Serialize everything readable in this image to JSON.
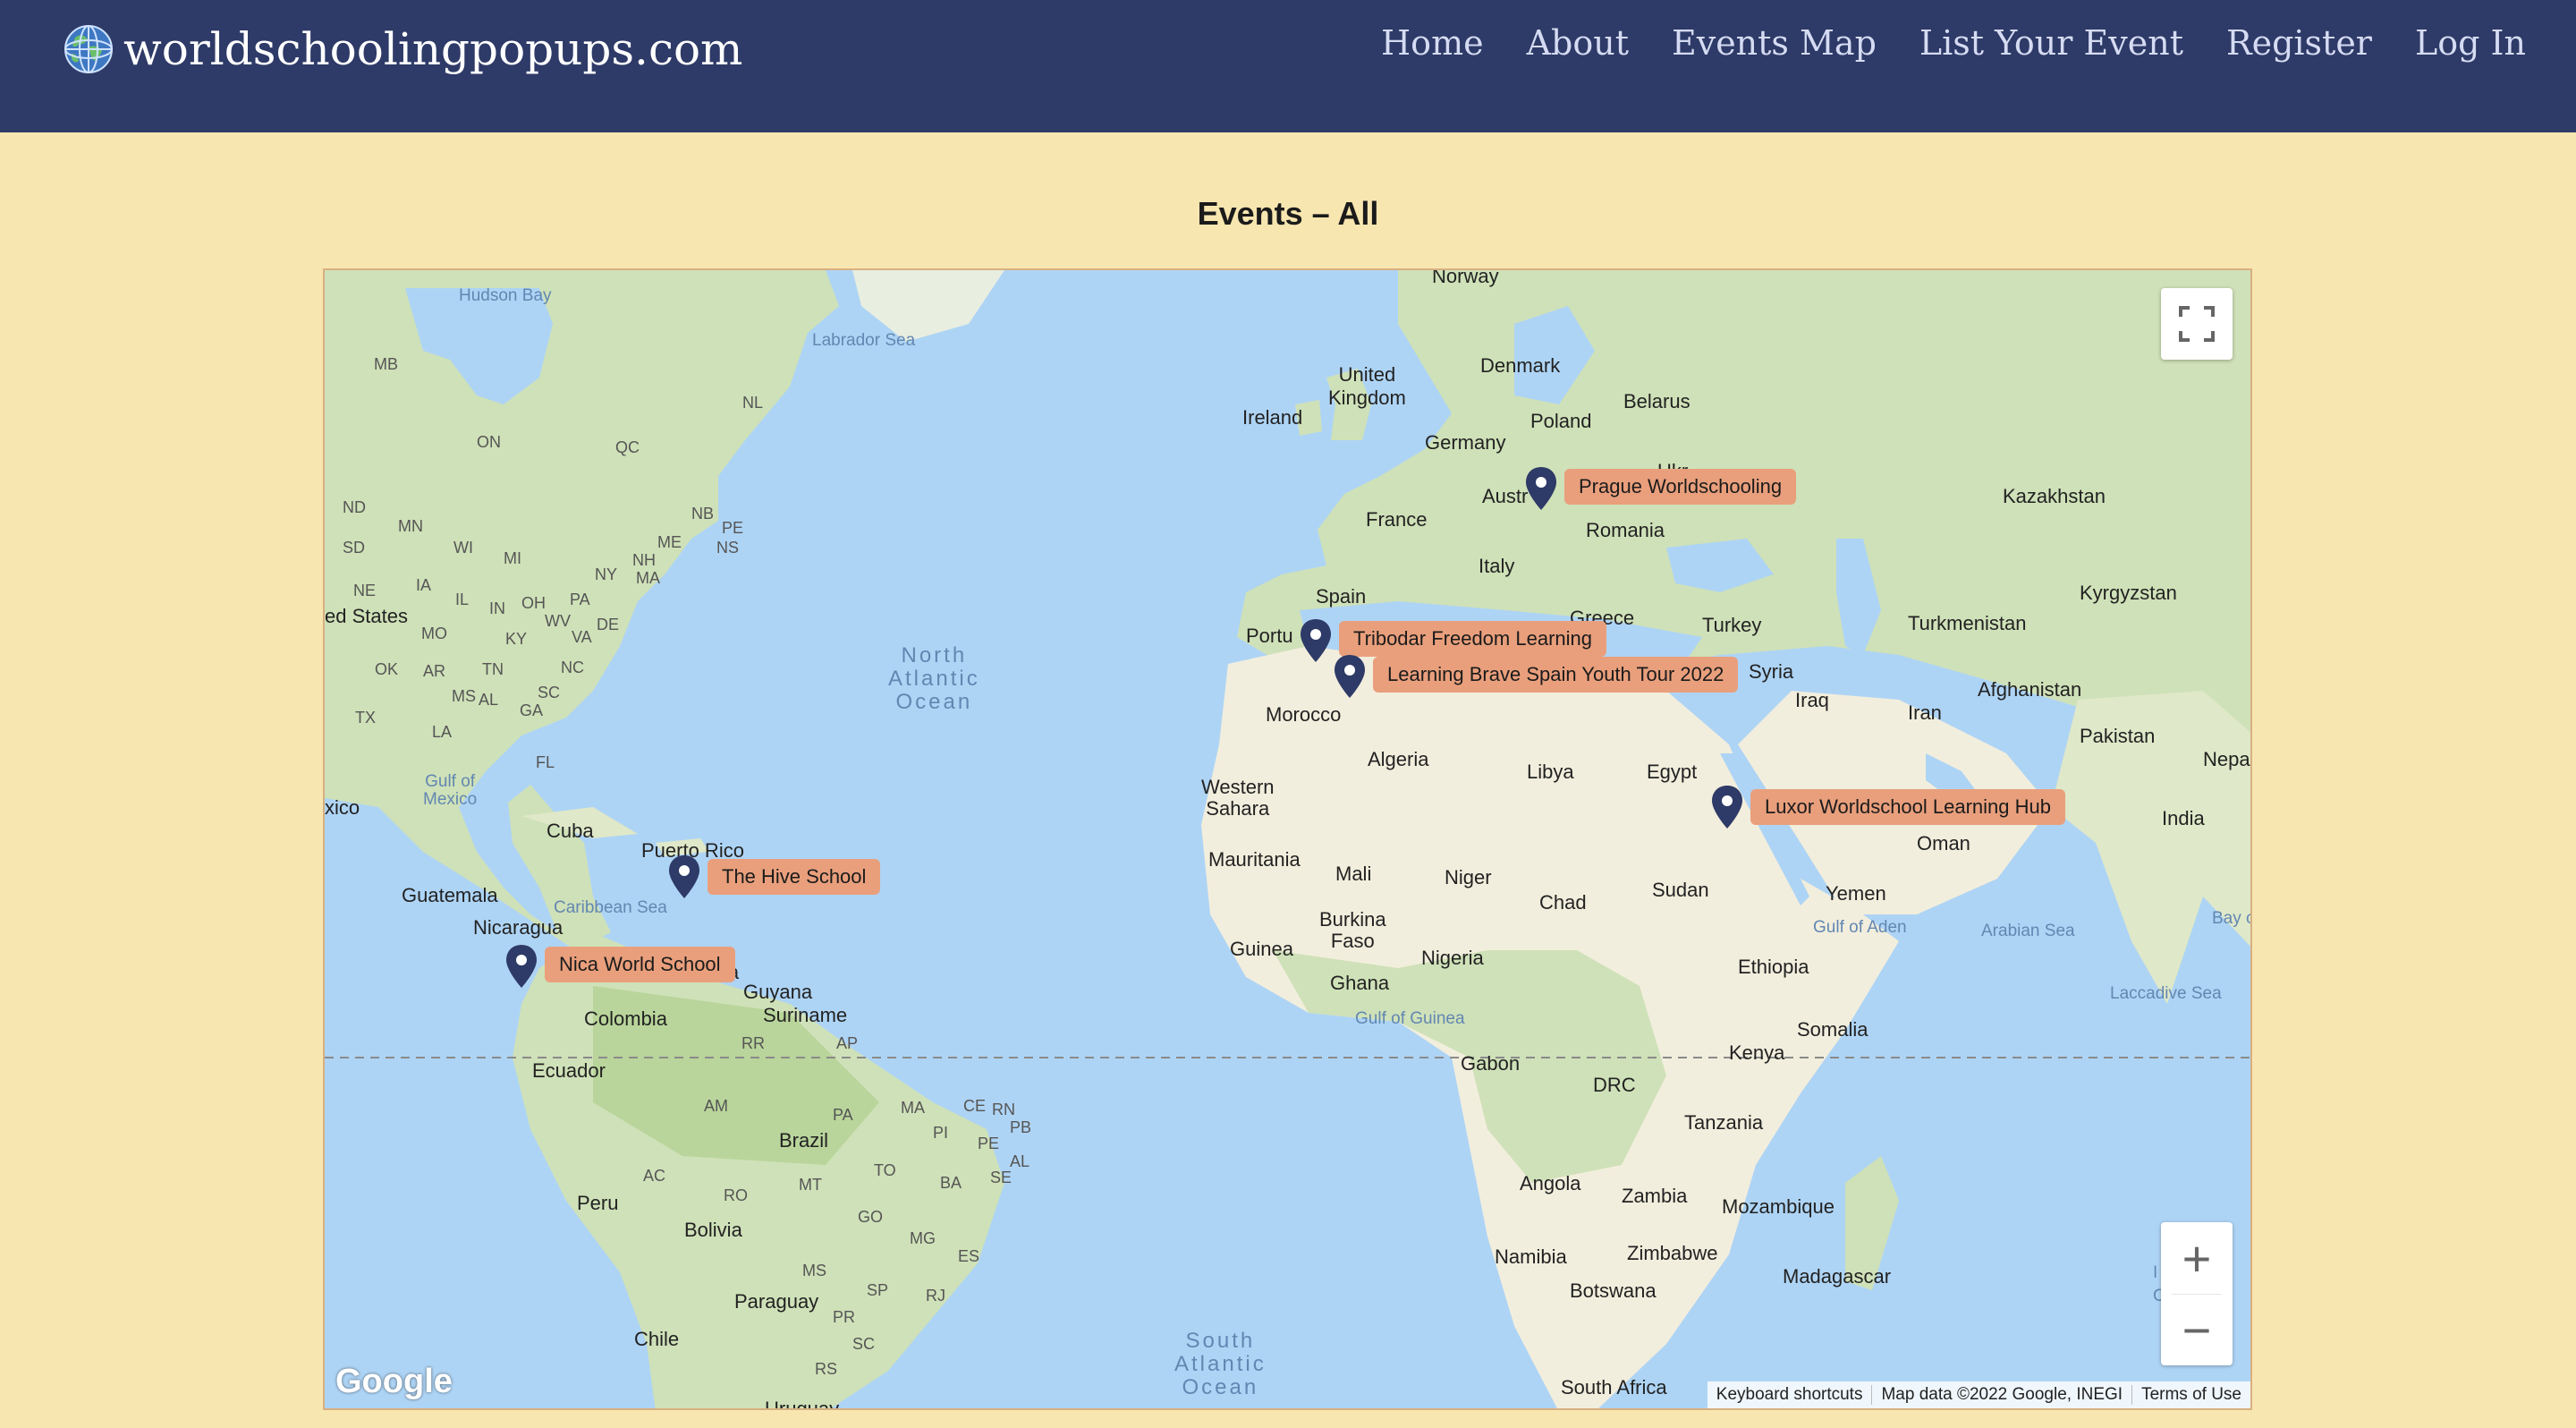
{
  "header": {
    "brand": "worldschoolingpopups.com",
    "nav": [
      "Home",
      "About",
      "Events Map",
      "List Your Event",
      "Register",
      "Log In"
    ]
  },
  "page": {
    "title": "Events – All"
  },
  "map": {
    "labels": {
      "hudson_bay": "Hudson Bay",
      "labrador_sea": "Labrador Sea",
      "mb": "MB",
      "on": "ON",
      "qc": "QC",
      "nl": "NL",
      "nd": "ND",
      "mn": "MN",
      "sd": "SD",
      "wi": "WI",
      "mi": "MI",
      "ne": "NE",
      "ia": "IA",
      "il": "IL",
      "in": "IN",
      "oh": "OH",
      "pa": "PA",
      "ny": "NY",
      "nh": "NH",
      "me": "ME",
      "ma": "MA",
      "nb": "NB",
      "pe": "PE",
      "ns": "NS",
      "de": "DE",
      "mo": "MO",
      "ky": "KY",
      "wv": "WV",
      "va": "VA",
      "ok": "OK",
      "ar": "AR",
      "tn": "TN",
      "nc": "NC",
      "tx": "TX",
      "ms": "MS",
      "al": "AL",
      "ga": "GA",
      "sc": "SC",
      "la": "LA",
      "fl": "FL",
      "united_states": "ed States",
      "gulf_of_mexico": "Gulf of\nMexico",
      "mexico": "xico",
      "cuba": "Cuba",
      "puerto_rico": "Puerto Rico",
      "caribbean_sea": "Caribbean Sea",
      "guatemala": "Guatemala",
      "nicaragua": "Nicaragua",
      "venezuela": "ia",
      "guyana": "Guyana",
      "suriname": "Suriname",
      "colombia": "Colombia",
      "rr": "RR",
      "ap": "AP",
      "ecuador": "Ecuador",
      "am": "AM",
      "pa_br": "PA",
      "ma_br": "MA",
      "ce": "CE",
      "rn": "RN",
      "pb": "PB",
      "pi": "PI",
      "pe_br": "PE",
      "al_br": "AL",
      "ac": "AC",
      "ro": "RO",
      "mt": "MT",
      "to": "TO",
      "ba": "BA",
      "se": "SE",
      "go": "GO",
      "mg": "MG",
      "es": "ES",
      "ms_br": "MS",
      "sp": "SP",
      "rj": "RJ",
      "pr": "PR",
      "sc_br": "SC",
      "rs": "RS",
      "brazil": "Brazil",
      "peru": "Peru",
      "bolivia": "Bolivia",
      "paraguay": "Paraguay",
      "chile": "Chile",
      "uruguay": "Uruguay",
      "north_atlantic": "North\nAtlantic\nOcean",
      "south_atlantic": "South\nAtlantic\nOcean",
      "norway": "Norway",
      "denmark": "Denmark",
      "united_kingdom": "United\nKingdom",
      "ireland": "Ireland",
      "belarus": "Belarus",
      "poland": "Poland",
      "germany": "Germany",
      "austria": "Austr",
      "ukraine": "Ukr",
      "kazakhstan": "Kazakhstan",
      "france": "France",
      "romania": "Romania",
      "italy": "Italy",
      "spain": "Spain",
      "portugal": "Portu",
      "greece": "Greece",
      "turkey": "Turkey",
      "turkmenistan": "Turkmenistan",
      "kyrgyzstan": "Kyrgyzstan",
      "syria": "Syria",
      "iraq": "Iraq",
      "iran": "Iran",
      "afghanistan": "Afghanistan",
      "pakistan": "Pakistan",
      "nepal": "Nepa",
      "morocco": "Morocco",
      "algeria": "Algeria",
      "libya": "Libya",
      "egypt": "Egypt",
      "western_sahara": "Western\nSahara",
      "india": "India",
      "oman": "Oman",
      "mauritania": "Mauritania",
      "mali": "Mali",
      "niger": "Niger",
      "chad": "Chad",
      "sudan": "Sudan",
      "yemen": "Yemen",
      "gulf_of_aden": "Gulf of Aden",
      "arabian_sea": "Arabian Sea",
      "bay": "Bay c",
      "guinea": "Guinea",
      "burkina_faso": "Burkina\nFaso",
      "nigeria": "Nigeria",
      "ethiopia": "Ethiopia",
      "ghana": "Ghana",
      "gulf_of_guinea": "Gulf of Guinea",
      "laccadive_sea": "Laccadive Sea",
      "somalia": "Somalia",
      "kenya": "Kenya",
      "gabon": "Gabon",
      "drc": "DRC",
      "tanzania": "Tanzania",
      "angola": "Angola",
      "zambia": "Zambia",
      "mozambique": "Mozambique",
      "namibia": "Namibia",
      "zimbabwe": "Zimbabwe",
      "madagascar": "Madagascar",
      "botswana": "Botswana",
      "south_africa": "South Africa",
      "edge_i": "I",
      "edge_c": "C"
    },
    "events": [
      {
        "name": "Prague Worldschooling"
      },
      {
        "name": "Tribodar Freedom Learning"
      },
      {
        "name": "Learning Brave Spain Youth Tour 2022"
      },
      {
        "name": "Luxor Worldschool Learning Hub"
      },
      {
        "name": "The Hive School"
      },
      {
        "name": "Nica World School"
      }
    ],
    "controls": {
      "zoom_in": "+",
      "zoom_out": "−"
    },
    "logo": "Google",
    "attribution": {
      "shortcuts": "Keyboard shortcuts",
      "data": "Map data ©2022 Google, INEGI",
      "terms": "Terms of Use"
    }
  },
  "colors": {
    "navbar": "#2e3a67",
    "page_background": "#f8e6b0",
    "water": "#aed4f5",
    "marker": "#2e3a67",
    "event_tag": "#e99f7c"
  }
}
